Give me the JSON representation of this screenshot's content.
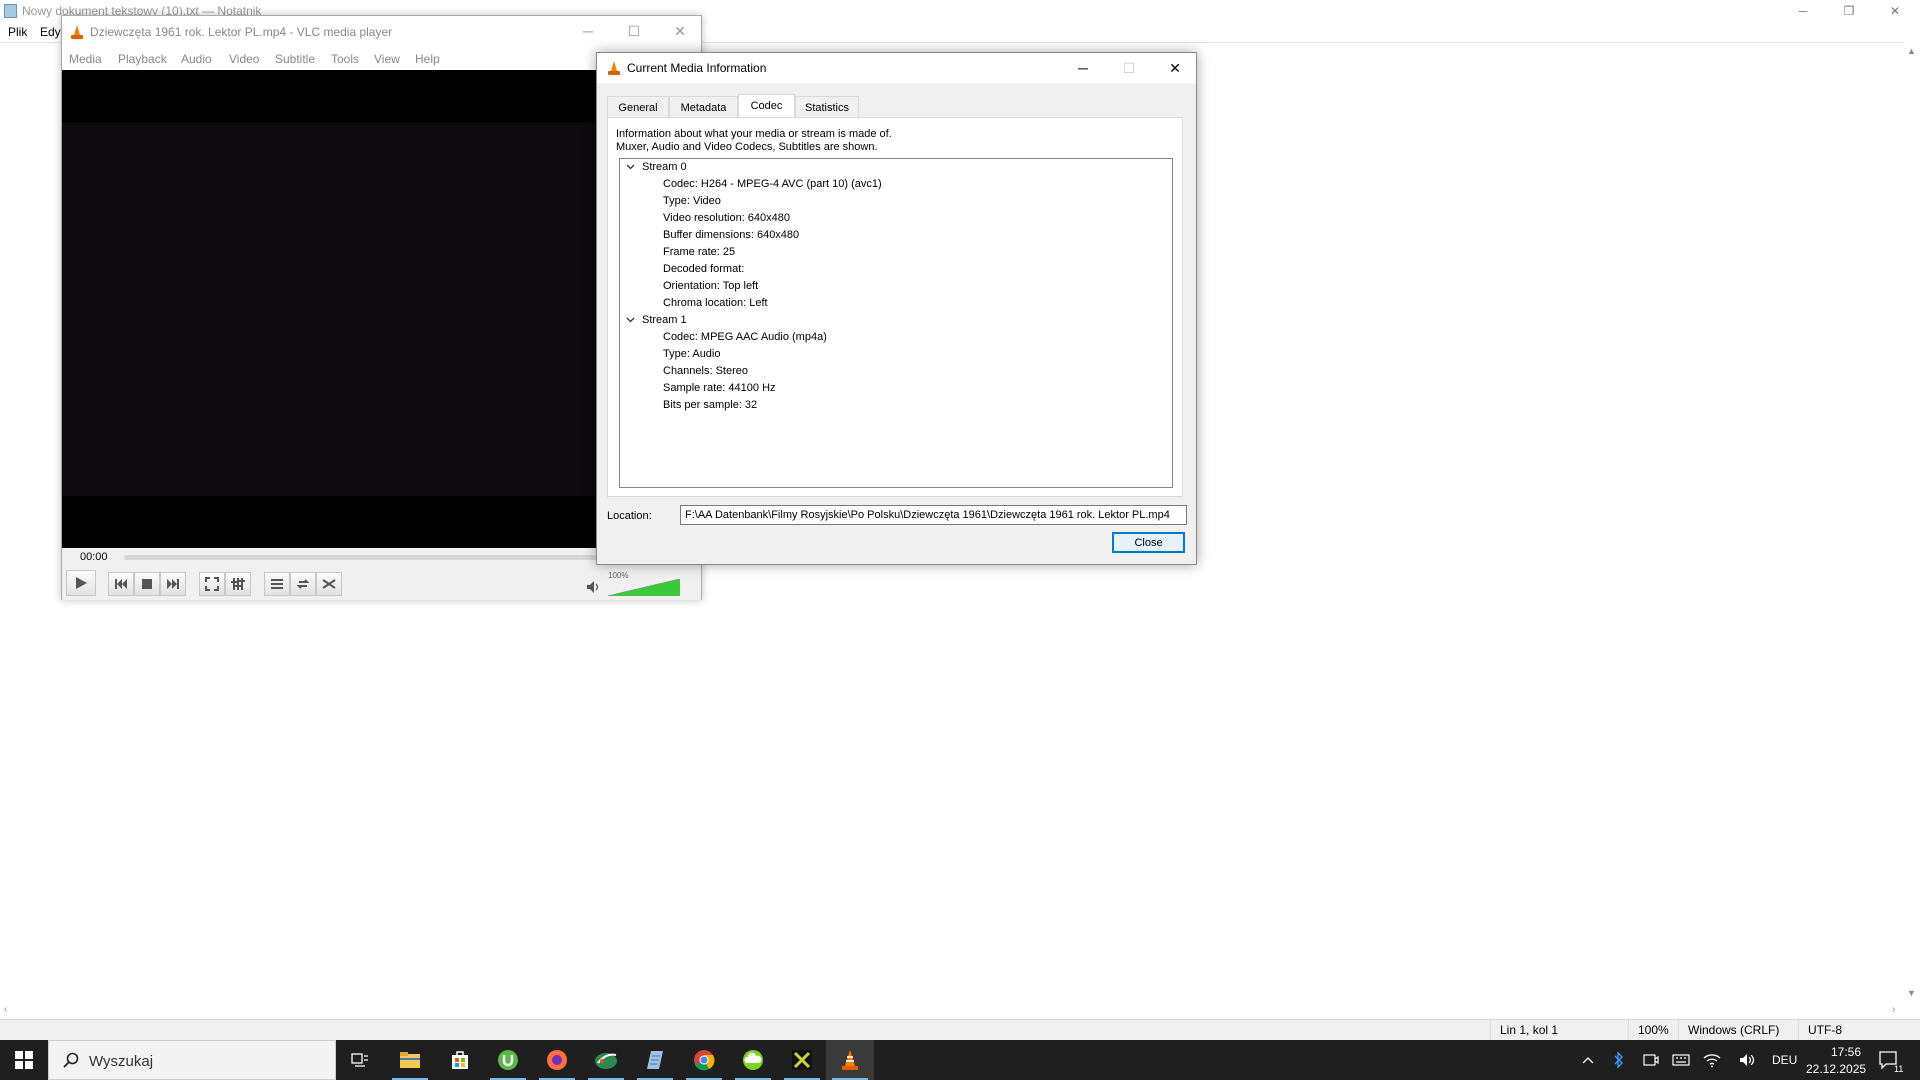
{
  "notepad": {
    "title": "Nowy dokument tekstowy (10).txt — Notatnik",
    "menu": [
      "Plik",
      "Edy"
    ],
    "status": {
      "position": "Lin 1, kol 1",
      "zoom": "100%",
      "line_endings": "Windows (CRLF)",
      "encoding": "UTF-8"
    }
  },
  "vlc": {
    "title": "Dziewczęta 1961 rok. Lektor PL.mp4 - VLC media player",
    "menu": [
      "Media",
      "Playback",
      "Audio",
      "Video",
      "Subtitle",
      "Tools",
      "View",
      "Help"
    ],
    "time": "00:00",
    "volume_label": "100%",
    "volume_level": 1.0
  },
  "dialog": {
    "title": "Current Media Information",
    "tabs": [
      "General",
      "Metadata",
      "Codec",
      "Statistics"
    ],
    "active_tab": "Codec",
    "description_line1": "Information about what your media or stream is made of.",
    "description_line2": "Muxer, Audio and Video Codecs, Subtitles are shown.",
    "streams": [
      {
        "label": "Stream 0",
        "items": [
          "Codec: H264 - MPEG-4 AVC (part 10) (avc1)",
          "Type: Video",
          "Video resolution: 640x480",
          "Buffer dimensions: 640x480",
          "Frame rate: 25",
          "Decoded format:",
          "Orientation: Top left",
          "Chroma location: Left"
        ]
      },
      {
        "label": "Stream 1",
        "items": [
          "Codec: MPEG AAC Audio (mp4a)",
          "Type: Audio",
          "Channels: Stereo",
          "Sample rate: 44100 Hz",
          "Bits per sample: 32"
        ]
      }
    ],
    "location_label": "Location:",
    "location_value": "F:\\AA Datenbank\\Filmy Rosyjskie\\Po Polsku\\Dziewczęta 1961\\Dziewczęta 1961 rok. Lektor PL.mp4",
    "close_label": "Close"
  },
  "taskbar": {
    "search_placeholder": "Wyszukaj",
    "language": "DEU",
    "time": "17:56",
    "date": "22.12.2025",
    "notification_count": "11"
  }
}
